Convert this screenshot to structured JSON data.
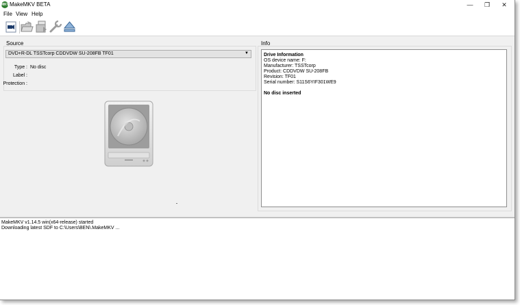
{
  "window": {
    "app_icon_text": "MKV",
    "title": "MakeMKV BETA",
    "controls": {
      "minimize": "—",
      "restore": "❐",
      "close": "✕"
    }
  },
  "menu": {
    "items": [
      "File",
      "View",
      "Help"
    ]
  },
  "toolbar": {
    "buttons": [
      "open-disc-icon",
      "open-files-icon",
      "backup-icon",
      "preferences-wrench-icon",
      "eject-icon"
    ]
  },
  "source": {
    "section_label": "Source",
    "drive_selected": "DVD+R-DL TSSTcorp CDDVDW SU-208FB TF01",
    "type_label": "Type :",
    "type_value": "No disc",
    "label_label": "Label :",
    "label_value": "",
    "protection_label": "Protection :",
    "protection_value": ""
  },
  "info": {
    "section_label": "Info",
    "heading": "Drive Information",
    "lines": [
      "OS device name: F:",
      "Manufacturer: TSSTcorp",
      "Product: CDDVDW SU-208FB",
      "Revision: TF01",
      "Serial number: S11S6YIF301WE9"
    ],
    "status": "No disc inserted"
  },
  "log": {
    "lines": [
      "MakeMKV v1.14.5 win(x64-release) started",
      "Downloading latest SDF to C:\\Users\\BEN\\.MakeMKV ..."
    ]
  },
  "colors": {
    "window_bg": "#f0f0f0",
    "panel_bg": "#ffffff",
    "border": "#8e8e8e",
    "app_icon": "#2f7d2f"
  }
}
